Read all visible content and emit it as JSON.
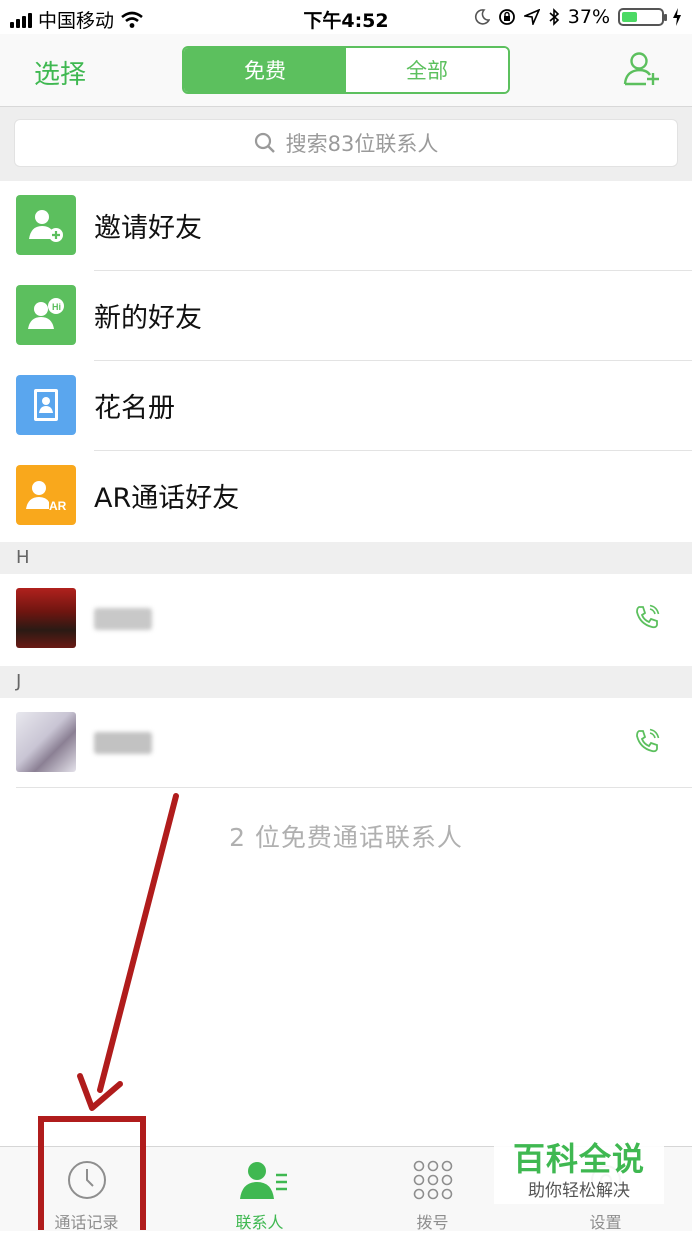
{
  "status_bar": {
    "carrier": "中国移动",
    "time": "下午4:52",
    "battery": "37%"
  },
  "nav": {
    "select_label": "选择",
    "tabs": [
      {
        "label": "免费",
        "active": true
      },
      {
        "label": "全部",
        "active": false
      }
    ],
    "add_contact_icon": "add-person-icon"
  },
  "search": {
    "placeholder": "搜索83位联系人"
  },
  "menu": [
    {
      "label": "邀请好友",
      "icon": "invite-friend-icon",
      "color": "#5cbf5e"
    },
    {
      "label": "新的好友",
      "icon": "new-friend-icon",
      "color": "#5cbf5e"
    },
    {
      "label": "花名册",
      "icon": "roster-icon",
      "color": "#5aa6ee"
    },
    {
      "label": "AR通话好友",
      "icon": "ar-friend-icon",
      "color": "#f9a81c"
    }
  ],
  "sections": [
    {
      "letter": "H"
    },
    {
      "letter": "J"
    }
  ],
  "summary": "2 位免费通话联系人",
  "tabbar": [
    {
      "label": "通话记录",
      "icon": "clock-icon",
      "active": false
    },
    {
      "label": "联系人",
      "icon": "contacts-icon",
      "active": true
    },
    {
      "label": "拨号",
      "icon": "dialpad-icon",
      "active": false
    },
    {
      "label": "设置",
      "icon": "settings-icon",
      "active": false
    }
  ],
  "watermark": {
    "title": "百科全说",
    "subtitle": "助你轻松解决"
  },
  "colors": {
    "accent": "#5cc05e",
    "annotation": "#b01c1c"
  }
}
